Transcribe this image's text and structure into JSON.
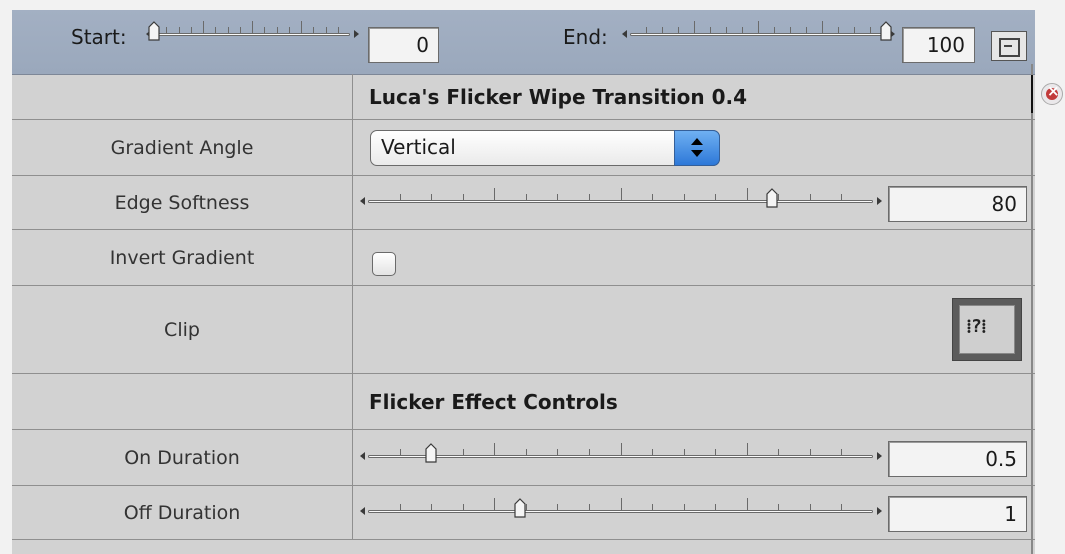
{
  "timeline": {
    "start_label": "Start:",
    "start_value": "0",
    "start_slider_level": 0,
    "end_label": "End:",
    "end_value": "100",
    "end_slider_level": 1
  },
  "header": {
    "title": "Luca's Flicker Wipe Transition 0.4"
  },
  "gradient_angle": {
    "label": "Gradient Angle",
    "selected": "Vertical"
  },
  "edge_softness": {
    "label": "Edge Softness",
    "value": "80",
    "slider_level": 0.8
  },
  "invert_gradient": {
    "label": "Invert Gradient",
    "checked": false
  },
  "clip": {
    "label": "Clip",
    "button_glyph": "⁞?⁞"
  },
  "flicker": {
    "title": "Flicker Effect Controls"
  },
  "on_duration": {
    "label": "On Duration",
    "value": "0.5",
    "slider_level": 0.125
  },
  "off_duration": {
    "label": "Off Duration",
    "value": "1",
    "slider_level": 0.3
  },
  "icons": {
    "close": "close-icon",
    "window": "window-icon",
    "popup_arrows": "up-down-arrows-icon"
  },
  "colors": {
    "toolbar": "#9eabbf",
    "panel": "#d2d2d2",
    "popup_accent": "#3f8be0",
    "close": "#c23b3b"
  }
}
